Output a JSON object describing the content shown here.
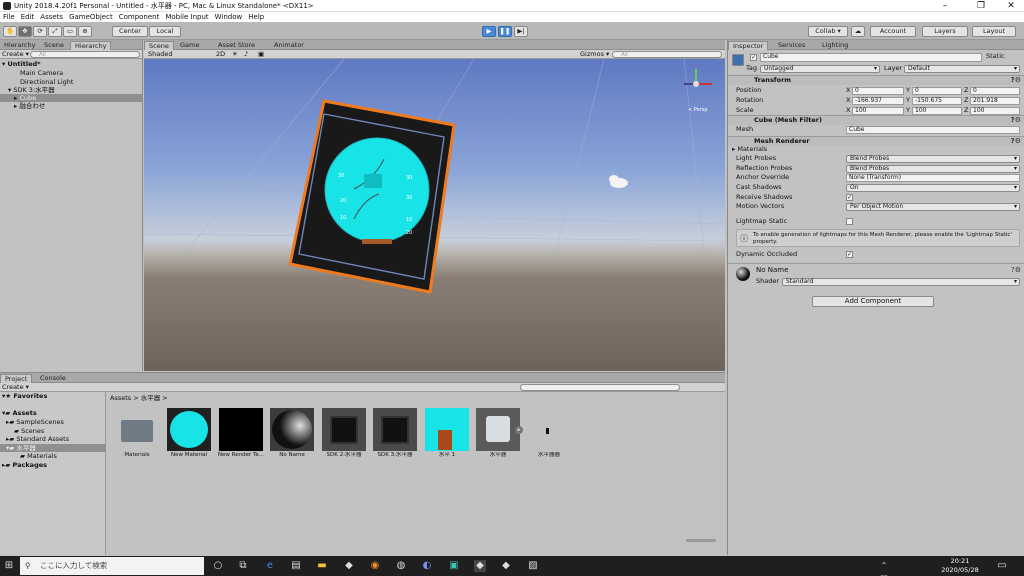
{
  "window": {
    "title": "Unity 2018.4.20f1 Personal - Untitled - 水平器 - PC, Mac & Linux Standalone* <DX11>"
  },
  "menu": [
    "File",
    "Edit",
    "Assets",
    "GameObject",
    "Component",
    "Mobile Input",
    "Window",
    "Help"
  ],
  "toolbar": {
    "pivot": "Center",
    "space": "Local",
    "collab": "Collab ▾",
    "account": "Account",
    "layers": "Layers",
    "layout": "Layout"
  },
  "hierarchy": {
    "tabs": [
      "Hierarchy",
      "Scene",
      "Hierarchy"
    ],
    "create": "Create ▾",
    "search_placeholder": "All",
    "items": [
      {
        "label": "Untitled*"
      },
      {
        "label": "Main Camera"
      },
      {
        "label": "Directional Light"
      },
      {
        "label": "SDK 3:水平器"
      },
      {
        "label": "Cube"
      },
      {
        "label": "融合わせ"
      }
    ]
  },
  "scene": {
    "tabs": [
      "Scene",
      "Game",
      "Asset Store",
      "Animator"
    ],
    "shading": "Shaded",
    "mode2d": "2D",
    "gizmos": "Gizmos ▾",
    "search_placeholder": "All",
    "persp": "≺ Persp",
    "ticks": [
      "30",
      "30",
      "20",
      "10",
      "10",
      "20",
      "30"
    ]
  },
  "inspector": {
    "tabs": [
      "Inspector",
      "Services",
      "Lighting"
    ],
    "object_name": "Cube",
    "static_label": "Static",
    "tag_label": "Tag",
    "tag_value": "Untagged",
    "layer_label": "Layer",
    "layer_value": "Default",
    "transform": {
      "title": "Transform",
      "position_label": "Position",
      "rotation_label": "Rotation",
      "scale_label": "Scale",
      "position": [
        "0",
        "0",
        "0"
      ],
      "rotation": [
        "-166.937",
        "-150.675",
        "201.918"
      ],
      "scale": [
        "100",
        "100",
        "100"
      ]
    },
    "mesh_filter": {
      "title": "Cube (Mesh Filter)",
      "mesh_label": "Mesh",
      "mesh_value": "Cube"
    },
    "mesh_renderer": {
      "title": "Mesh Renderer",
      "materials_label": "Materials",
      "light_probes_label": "Light Probes",
      "light_probes_value": "Blend Probes",
      "reflection_probes_label": "Reflection Probes",
      "reflection_probes_value": "Blend Probes",
      "anchor_override_label": "Anchor Override",
      "anchor_override_value": "None (Transform)",
      "cast_shadows_label": "Cast Shadows",
      "cast_shadows_value": "On",
      "receive_shadows_label": "Receive Shadows",
      "motion_vectors_label": "Motion Vectors",
      "motion_vectors_value": "Per Object Motion",
      "lightmap_static_label": "Lightmap Static",
      "info": "To enable generation of lightmaps for this Mesh Renderer, please enable the 'Lightmap Static' property.",
      "dynamic_occluded_label": "Dynamic Occluded"
    },
    "material": {
      "name": "No Name",
      "shader_label": "Shader",
      "shader_value": "Standard"
    },
    "add_component": "Add Component"
  },
  "project": {
    "tabs": [
      "Project",
      "Console"
    ],
    "create": "Create ▾",
    "breadcrumb": "Assets > 水平器 >",
    "tree": [
      {
        "label": "Favorites"
      },
      {
        "label": "Assets"
      },
      {
        "label": "SampleScenes"
      },
      {
        "label": "Scenes"
      },
      {
        "label": "Standard Assets"
      },
      {
        "label": "水平器"
      },
      {
        "label": "Materials"
      },
      {
        "label": "Packages"
      }
    ],
    "assets": [
      {
        "label": "Materials"
      },
      {
        "label": "New Material"
      },
      {
        "label": "New Render Te..."
      },
      {
        "label": "No Name"
      },
      {
        "label": "SDK 2:水平器"
      },
      {
        "label": "SDK 3:水平器"
      },
      {
        "label": "水平 1"
      },
      {
        "label": "水平器"
      },
      {
        "label": "水平器器"
      }
    ]
  },
  "taskbar": {
    "search_placeholder": "ここに入力して検索",
    "time": "20:21",
    "date": "2020/05/28"
  },
  "colors": {
    "accent": "#4a88d4",
    "cyan": "#18e4e8",
    "selection_outline": "#f07a1e"
  }
}
